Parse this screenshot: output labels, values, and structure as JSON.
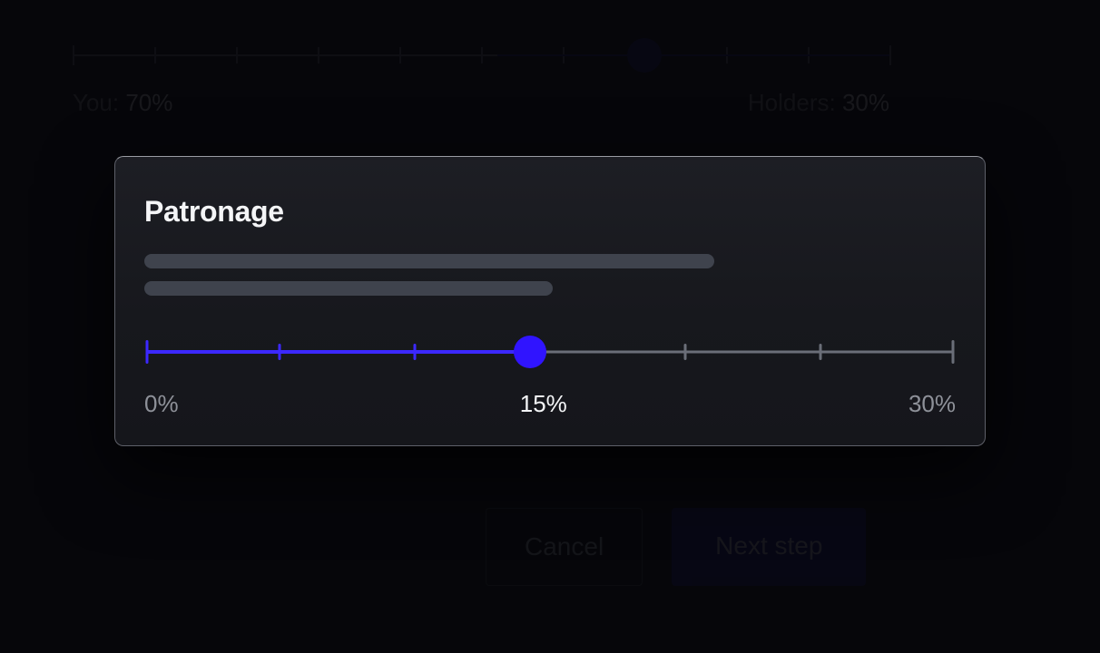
{
  "background": {
    "you_label": "You:",
    "you_value": "70%",
    "holders_label": "Holders:",
    "holders_value": "30%"
  },
  "buttons": {
    "cancel": "Cancel",
    "next": "Next step"
  },
  "modal": {
    "title": "Patronage",
    "slider": {
      "min_label": "0%",
      "value_label": "15%",
      "max_label": "30%",
      "min": 0,
      "max": 30,
      "value": 15,
      "percent": 47.5
    }
  }
}
